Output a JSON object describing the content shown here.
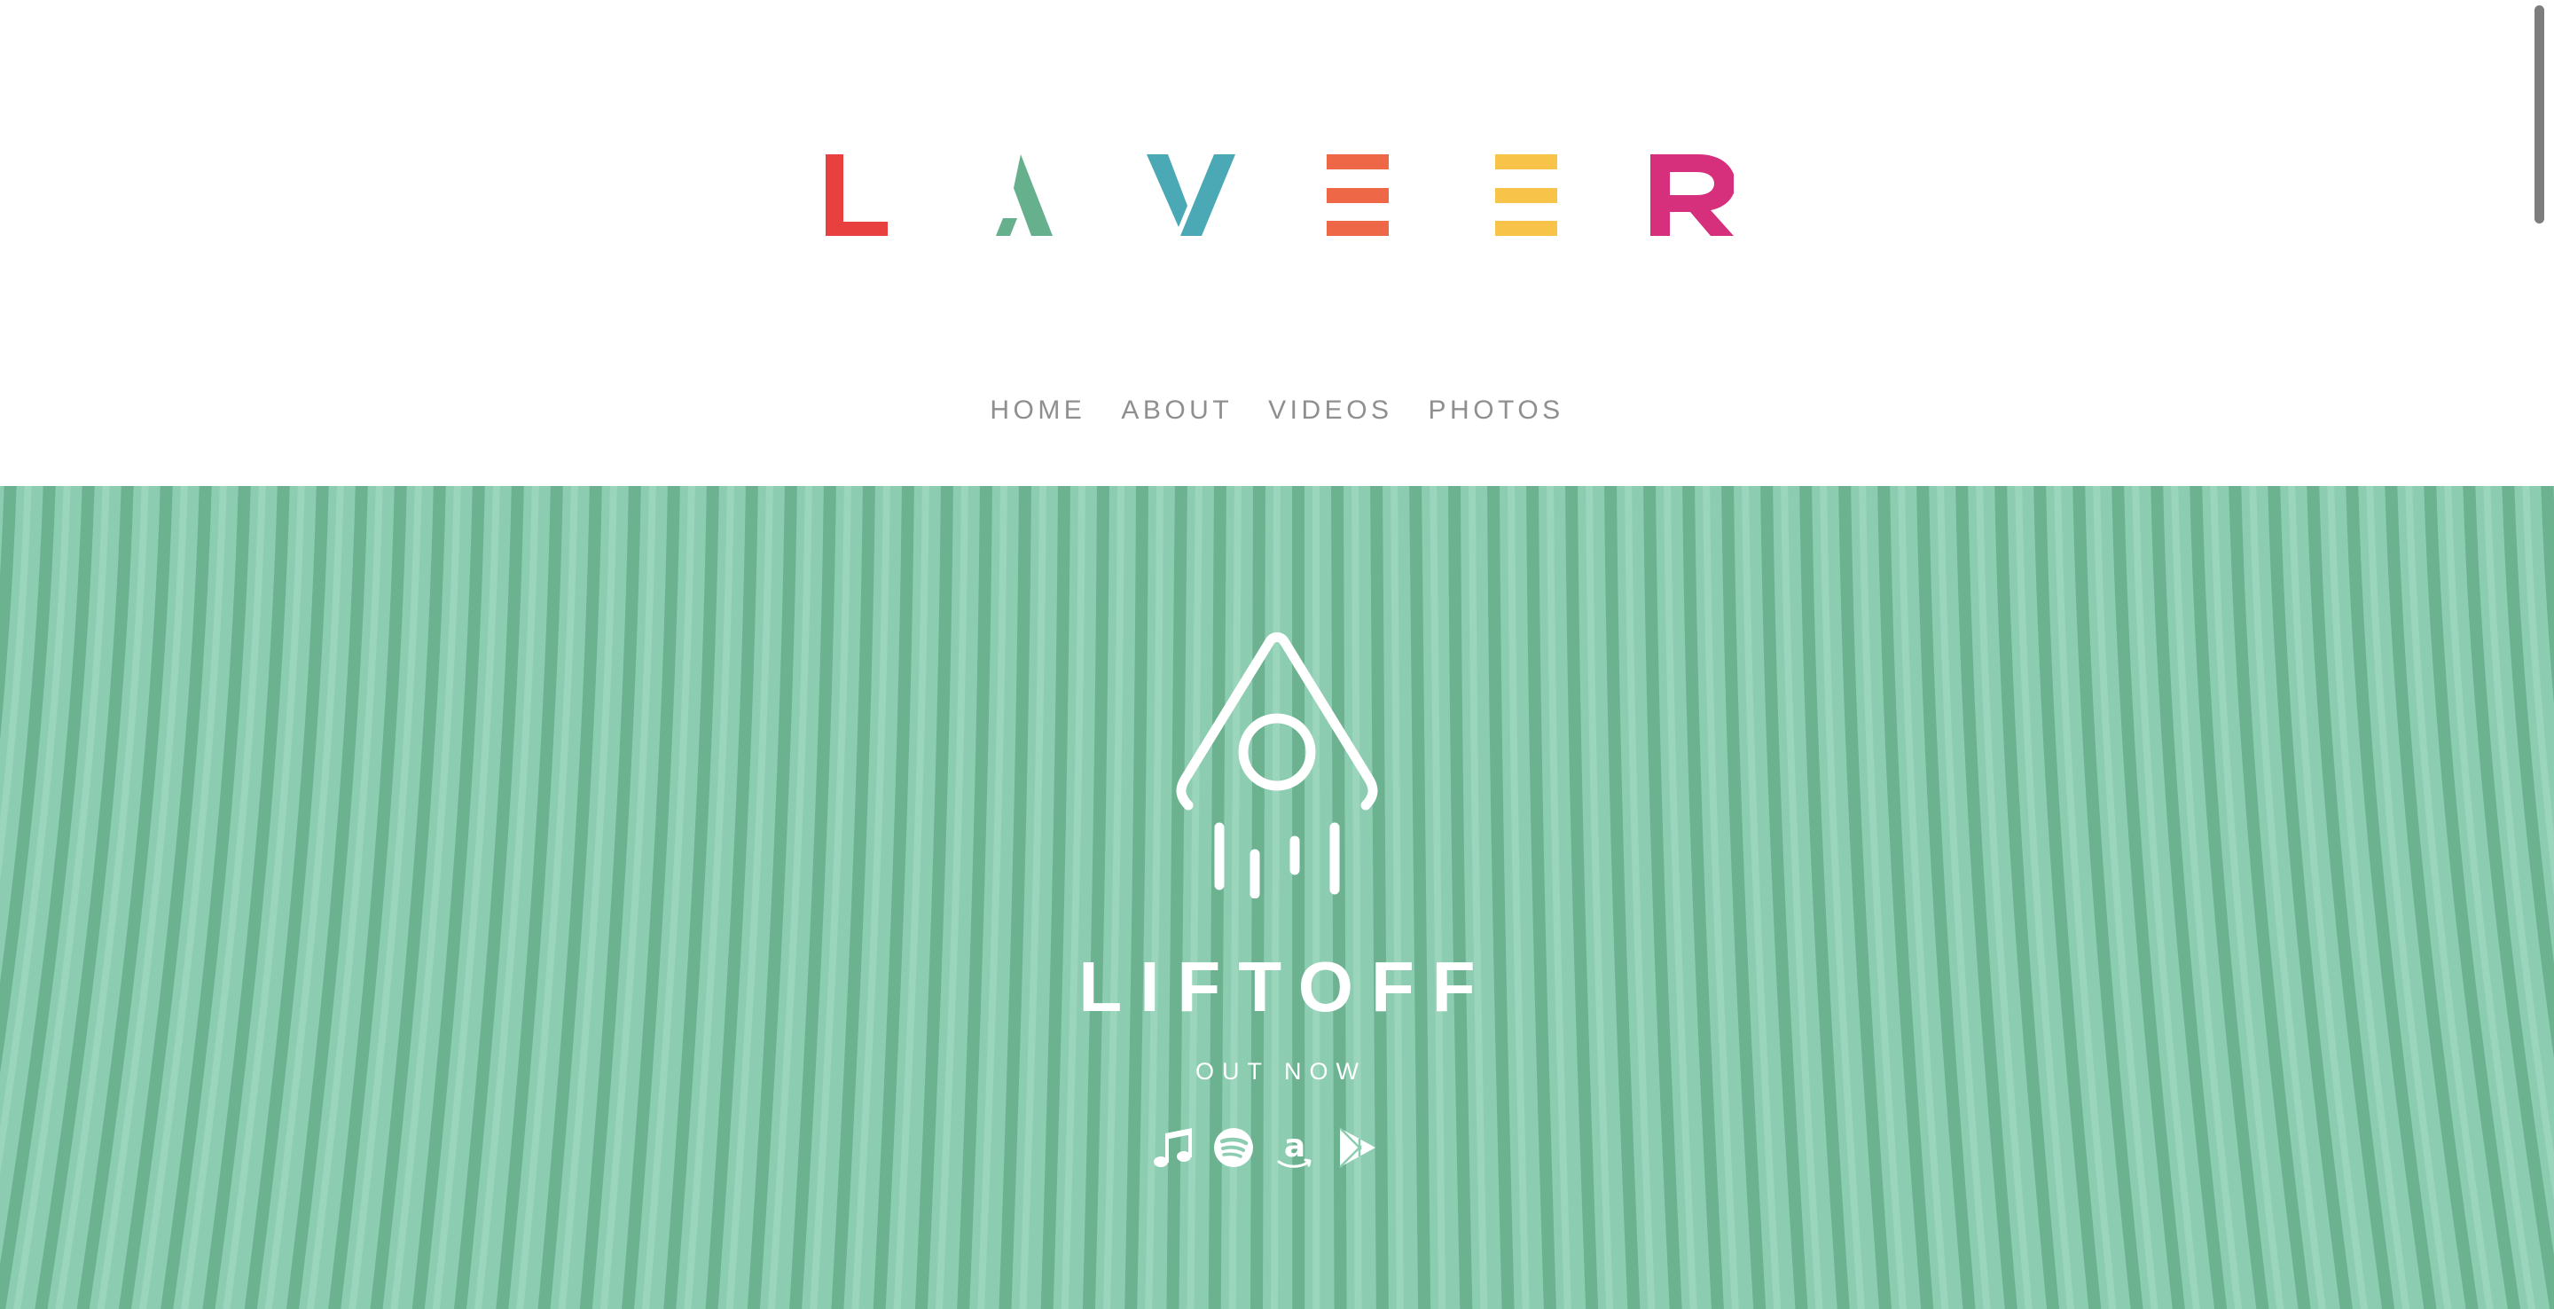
{
  "brand": {
    "name": "LAVEER",
    "letters": [
      {
        "char": "L",
        "color": "#e8403f"
      },
      {
        "char": "A",
        "color": "#67b08e"
      },
      {
        "char": "V",
        "color": "#4aa9b4"
      },
      {
        "char": "E",
        "color": "#ee6848"
      },
      {
        "char": "E",
        "color": "#f7c348"
      },
      {
        "char": "R",
        "color": "#d6307c"
      }
    ]
  },
  "nav": {
    "items": [
      {
        "label": "HOME"
      },
      {
        "label": "ABOUT"
      },
      {
        "label": "VIDEOS"
      },
      {
        "label": "PHOTOS"
      }
    ]
  },
  "hero": {
    "background_color": "#8ccdb1",
    "stripe_color": "#66ad8c",
    "icon": "rocket-icon",
    "title": "LIFTOFF",
    "subtitle": "OUT NOW",
    "stores": [
      {
        "icon": "itunes-music-note-icon",
        "name": "iTunes"
      },
      {
        "icon": "spotify-icon",
        "name": "Spotify"
      },
      {
        "icon": "amazon-icon",
        "name": "Amazon"
      },
      {
        "icon": "google-play-icon",
        "name": "Google Play"
      }
    ]
  }
}
